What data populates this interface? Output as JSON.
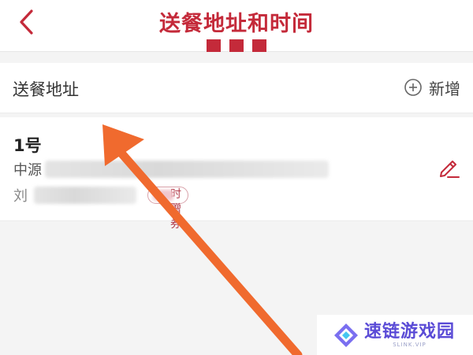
{
  "header": {
    "title": "送餐地址和时间",
    "back_icon": "chevron-left-icon",
    "menu_icon": "menu-dots-icon",
    "accent_color": "#c42a3a"
  },
  "address_section": {
    "label": "送餐地址",
    "add_label": "新增",
    "add_icon": "plus-circle-icon"
  },
  "address_card": {
    "name": "1号",
    "address_prefix": "中源",
    "contact_prefix": "刘",
    "coupon_badge": "时赠券",
    "edit_icon": "pencil-icon"
  },
  "watermark": {
    "title": "速链游戏园",
    "subtitle": "SLINK.VIP",
    "icon": "diamond-logo-icon"
  }
}
